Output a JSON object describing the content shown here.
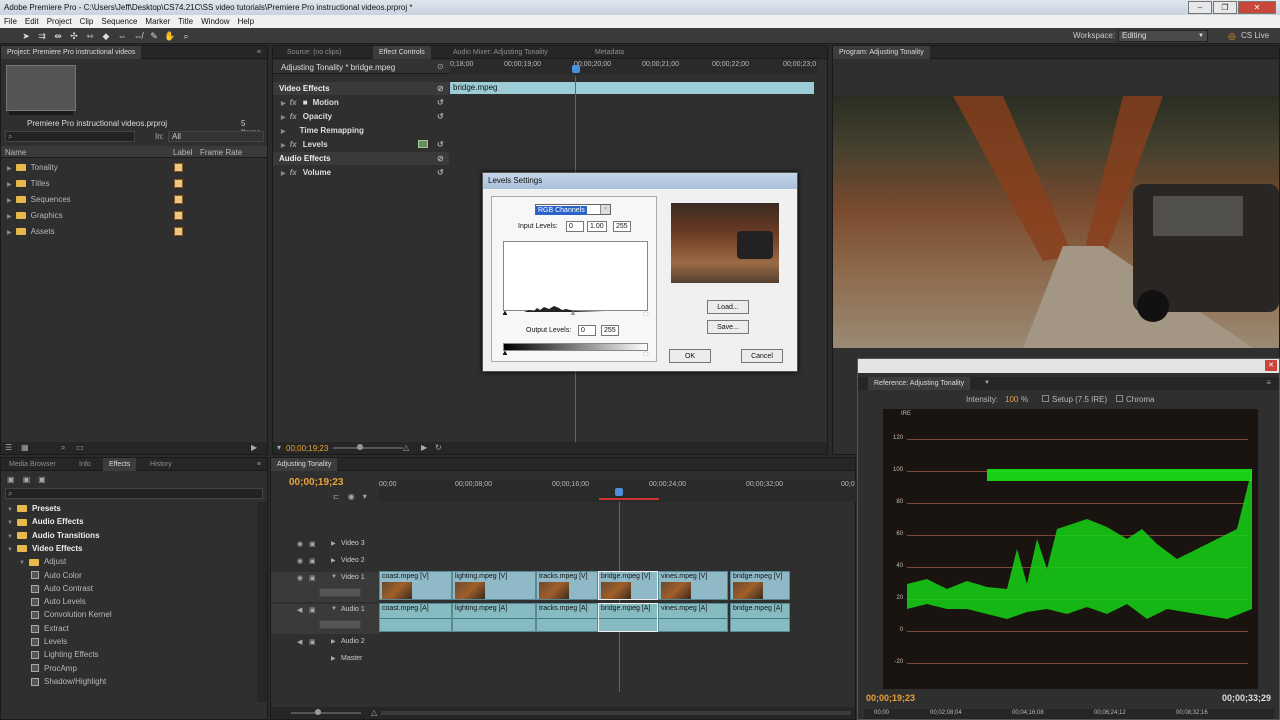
{
  "window": {
    "title": "Adobe Premiere Pro - C:\\Users\\Jeff\\Desktop\\CS74.21C\\SS video tutorials\\Premiere Pro instructional videos.prproj *",
    "buttons": [
      "–",
      "❐",
      "✕"
    ]
  },
  "menu": [
    "File",
    "Edit",
    "Project",
    "Clip",
    "Sequence",
    "Marker",
    "Title",
    "Window",
    "Help"
  ],
  "workspace": {
    "label": "Workspace:",
    "value": "Editing",
    "cslive": "CS Live"
  },
  "project": {
    "tab": "Project: Premiere Pro instructional videos",
    "name": "Premiere Pro instructional videos.prproj",
    "items": "5 Items",
    "in_label": "In:",
    "in_value": "All",
    "columns": [
      "Name",
      "Label",
      "Frame Rate"
    ],
    "bins": [
      "Tonality",
      "Titles",
      "Sequences",
      "Graphics",
      "Assets"
    ]
  },
  "source_tabs": [
    "Source: (no clips)",
    "Effect Controls",
    "Audio Mixer: Adjusting Tonality",
    "Metadata"
  ],
  "effect_controls": {
    "clip": "Adjusting Tonality * bridge.mpeg",
    "ruler": [
      "0;18;00",
      "00;00;19;00",
      "00;00;20;00",
      "00;00;21;00",
      "00;00;22;00",
      "00;00;23;0"
    ],
    "clipbar": "bridge.mpeg",
    "video_effects": "Video Effects",
    "effects": [
      "Motion",
      "Opacity",
      "Time Remapping",
      "Levels"
    ],
    "audio_effects": "Audio Effects",
    "audio": [
      "Volume"
    ],
    "timecode": "00;00;19;23"
  },
  "levels_dialog": {
    "title": "Levels Settings",
    "channel": "RGB Channels",
    "input_label": "Input Levels:",
    "input_values": [
      "0",
      "1.00",
      "255"
    ],
    "output_label": "Output Levels:",
    "output_values": [
      "0",
      "255"
    ],
    "load": "Load...",
    "save": "Save...",
    "ok": "OK",
    "cancel": "Cancel"
  },
  "program": {
    "tab": "Program: Adjusting Tonality"
  },
  "reference": {
    "tab": "Reference: Adjusting Tonality",
    "intensity_label": "Intensity:",
    "intensity_value": "100",
    "intensity_unit": "%",
    "setup": "Setup (7.5 IRE)",
    "chroma": "Chroma",
    "ire": "IRE",
    "scale": [
      "120",
      "100",
      "80",
      "60",
      "40",
      "20",
      "0",
      "-20"
    ],
    "timecode_left": "00;00;19;23",
    "timecode_right": "00;00;33;29",
    "ruler": [
      "00;00",
      "00;02;08;04",
      "00;04;16;08",
      "00;06;24;12",
      "00;08;32;16"
    ]
  },
  "effects_panel": {
    "tabs": [
      "Media Browser",
      "Info",
      "Effects",
      "History"
    ],
    "tree": [
      {
        "label": "Presets",
        "level": 0,
        "bold": true
      },
      {
        "label": "Audio Effects",
        "level": 0,
        "bold": true
      },
      {
        "label": "Audio Transitions",
        "level": 0,
        "bold": true
      },
      {
        "label": "Video Effects",
        "level": 0,
        "bold": true
      },
      {
        "label": "Adjust",
        "level": 1,
        "bold": false
      },
      {
        "label": "Auto Color",
        "level": 2,
        "bold": false
      },
      {
        "label": "Auto Contrast",
        "level": 2,
        "bold": false
      },
      {
        "label": "Auto Levels",
        "level": 2,
        "bold": false
      },
      {
        "label": "Convolution Kernel",
        "level": 2,
        "bold": false
      },
      {
        "label": "Extract",
        "level": 2,
        "bold": false
      },
      {
        "label": "Levels",
        "level": 2,
        "bold": false
      },
      {
        "label": "Lighting Effects",
        "level": 2,
        "bold": false
      },
      {
        "label": "ProcAmp",
        "level": 2,
        "bold": false
      },
      {
        "label": "Shadow/Highlight",
        "level": 2,
        "bold": false
      }
    ]
  },
  "timeline": {
    "tab": "Adjusting Tonality",
    "timecode": "00;00;19;23",
    "ruler": [
      "00;00",
      "00;00;08;00",
      "00;00;16;00",
      "00;00;24;00",
      "00;00;32;00",
      "00;0"
    ],
    "tracks": [
      "Video 3",
      "Video 2",
      "Video 1",
      "Audio 1",
      "Audio 2",
      "Master"
    ],
    "video_clips": [
      "coast.mpeg [V]",
      "lighting.mpeg [V]",
      "tracks.mpeg [V]",
      "bridge.mpeg [V]",
      "vines.mpeg [V]",
      "bridge.mpeg [V]"
    ],
    "audio_clips": [
      "coast.mpeg [A]",
      "lighting.mpeg [A]",
      "tracks.mpeg [A]",
      "bridge.mpeg [A]",
      "vines.mpeg [A]",
      "bridge.mpeg [A]"
    ],
    "video_fx_labels": [
      "ity",
      "ity",
      "ity"
    ],
    "audio_fx_labels": [
      "el",
      "vel",
      "el"
    ]
  }
}
